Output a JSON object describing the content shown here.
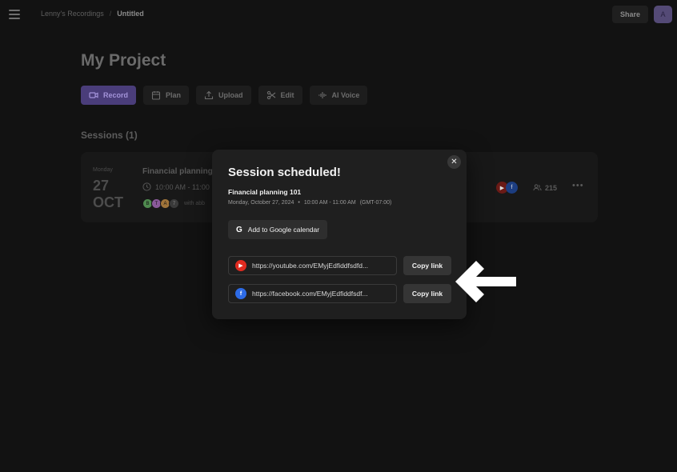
{
  "breadcrumb": {
    "root": "Lenny's Recordings",
    "separator": "/",
    "current": "Untitled"
  },
  "header": {
    "share_label": "Share",
    "avatar_initial": "A"
  },
  "project": {
    "title": "My Project"
  },
  "actions": [
    {
      "label": "Record",
      "icon": "record-icon"
    },
    {
      "label": "Plan",
      "icon": "calendar-icon"
    },
    {
      "label": "Upload",
      "icon": "upload-icon"
    },
    {
      "label": "Edit",
      "icon": "scissors-icon"
    },
    {
      "label": "AI Voice",
      "icon": "ai-voice-icon"
    }
  ],
  "sessions": {
    "heading": "Sessions (1)",
    "items": [
      {
        "day": "Monday",
        "date": "27",
        "month": "OCT",
        "title": "Financial planning",
        "time": "10:00 AM - 11:00",
        "people": [
          "B",
          "T",
          "A",
          "7"
        ],
        "with_text": "with abb",
        "platforms": [
          "youtube",
          "facebook"
        ],
        "count": "215"
      }
    ]
  },
  "modal": {
    "title": "Session scheduled!",
    "event_name": "Financial planning 101",
    "date": "Monday, October 27, 2024",
    "bullet": "•",
    "time": "10:00 AM - 11:00 AM",
    "timezone": "(GMT-07:00)",
    "gcal_label": "Add to Google calendar",
    "gcal_icon_letter": "G",
    "close_icon": "✕",
    "links": [
      {
        "platform": "youtube",
        "url": "https://youtube.com/EMyjEdfiddfsdfd...",
        "copy_label": "Copy link"
      },
      {
        "platform": "facebook",
        "url": "https://facebook.com/EMyjEdfiddfsdf...",
        "copy_label": "Copy link"
      }
    ]
  },
  "colors": {
    "background": "#121212",
    "modal": "#1f1f1f",
    "accent": "#4a3d7a",
    "youtube": "#e02b20",
    "facebook": "#2d6be6"
  }
}
